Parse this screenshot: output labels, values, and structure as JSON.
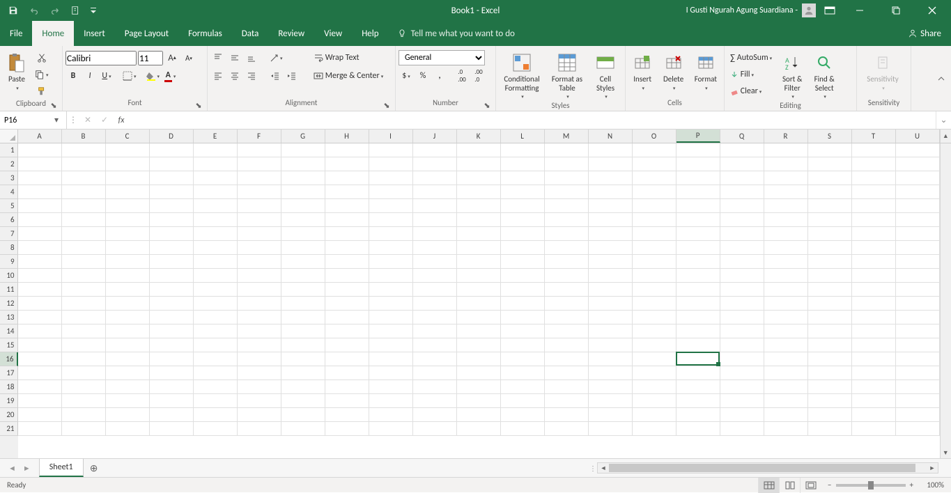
{
  "app": {
    "title": "Book1  -  Excel",
    "user": "I Gusti Ngurah Agung Suardiana -"
  },
  "tabs": {
    "file": "File",
    "home": "Home",
    "insert": "Insert",
    "pageLayout": "Page Layout",
    "formulas": "Formulas",
    "data": "Data",
    "review": "Review",
    "view": "View",
    "help": "Help",
    "tellme": "Tell me what you want to do",
    "share": "Share",
    "active": "home"
  },
  "ribbon": {
    "clipboard": {
      "paste": "Paste",
      "label": "Clipboard"
    },
    "font": {
      "name": "Calibri",
      "size": "11",
      "label": "Font"
    },
    "alignment": {
      "wrap": "Wrap Text",
      "merge": "Merge & Center",
      "label": "Alignment"
    },
    "number": {
      "format": "General",
      "label": "Number"
    },
    "styles": {
      "cond": "Conditional Formatting",
      "table": "Format as Table",
      "cell": "Cell Styles",
      "label": "Styles"
    },
    "cells": {
      "insert": "Insert",
      "delete": "Delete",
      "format": "Format",
      "label": "Cells"
    },
    "editing": {
      "autosum": "AutoSum",
      "fill": "Fill",
      "clear": "Clear",
      "sort": "Sort & Filter",
      "find": "Find & Select",
      "label": "Editing"
    },
    "sensitivity": {
      "btn": "Sensitivity",
      "label": "Sensitivity"
    }
  },
  "namebox": "P16",
  "formula": "",
  "columns": [
    "A",
    "B",
    "C",
    "D",
    "E",
    "F",
    "G",
    "H",
    "I",
    "J",
    "K",
    "L",
    "M",
    "N",
    "O",
    "P",
    "Q",
    "R",
    "S",
    "T",
    "U"
  ],
  "rows": [
    1,
    2,
    3,
    4,
    5,
    6,
    7,
    8,
    9,
    10,
    11,
    12,
    13,
    14,
    15,
    16,
    17,
    18,
    19,
    20,
    21
  ],
  "selection": {
    "col": "P",
    "colIndex": 15,
    "row": 16
  },
  "sheet": {
    "name": "Sheet1"
  },
  "status": {
    "ready": "Ready",
    "zoom": "100%"
  }
}
